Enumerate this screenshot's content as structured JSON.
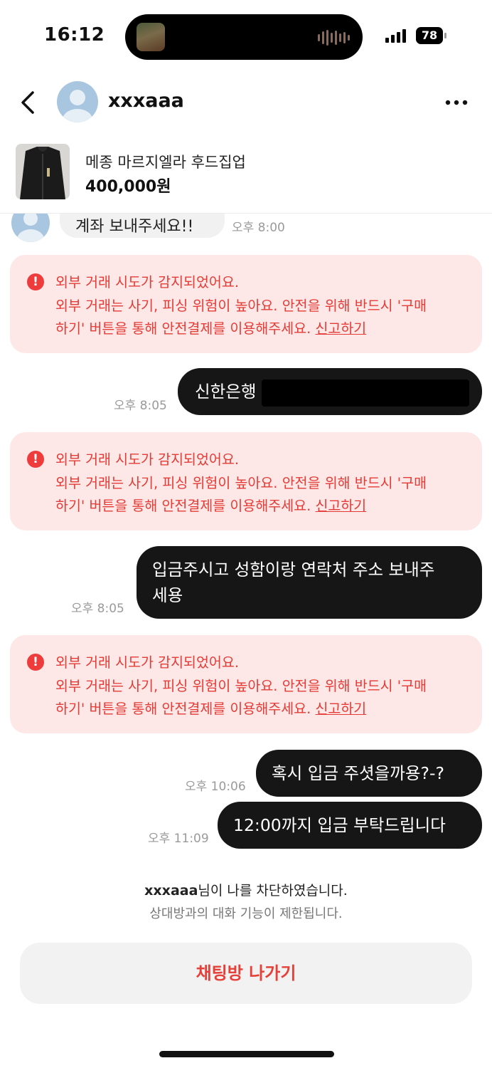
{
  "status_bar": {
    "time": "16:12",
    "battery": "78"
  },
  "header": {
    "username": "xxxaaa"
  },
  "product": {
    "title": "메종 마르지엘라 후드집업",
    "price": "400,000원"
  },
  "chat": {
    "partial_message": {
      "text": "계좌 보내주세요!!",
      "time": "오후 8:00"
    },
    "alert": {
      "line1": "외부 거래 시도가 감지되었어요.",
      "line2": "외부 거래는 사기, 피싱 위험이 높아요. 안전을 위해 반드시 '구매",
      "line3": "하기' 버튼을 통해 안전결제를 이용해주세요.",
      "report": "신고하기"
    },
    "messages": [
      {
        "text": "신한은행",
        "time": "오후 8:05"
      },
      {
        "line1": "입금주시고 성함이랑 연락처 주소 보내주",
        "line2": "세용",
        "time": "오후 8:05"
      },
      {
        "text": "혹시 입금 주셧을까용?-?",
        "time": "오후 10:06"
      },
      {
        "text": "12:00까지 입금 부탁드립니다",
        "time": "오후 11:09"
      }
    ]
  },
  "blocked_notice": {
    "name": "xxxaaa",
    "suffix": "님이 나를 차단하였습니다.",
    "line2": "상대방과의 대화 기능이 제한됩니다."
  },
  "leave_button": "채팅방 나가기"
}
